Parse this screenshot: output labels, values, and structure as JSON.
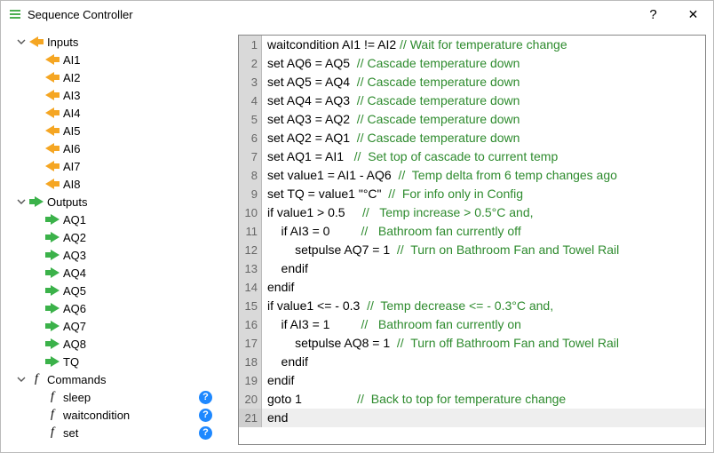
{
  "window": {
    "title": "Sequence Controller",
    "help_symbol": "?",
    "close_symbol": "✕"
  },
  "tree": {
    "inputs": {
      "label": "Inputs",
      "items": [
        "AI1",
        "AI2",
        "AI3",
        "AI4",
        "AI5",
        "AI6",
        "AI7",
        "AI8"
      ]
    },
    "outputs": {
      "label": "Outputs",
      "items": [
        "AQ1",
        "AQ2",
        "AQ3",
        "AQ4",
        "AQ5",
        "AQ6",
        "AQ7",
        "AQ8",
        "TQ"
      ]
    },
    "commands": {
      "label": "Commands",
      "items": [
        "sleep",
        "waitcondition",
        "set"
      ]
    },
    "help_badge": "?"
  },
  "code": {
    "current_line": 21,
    "lines": [
      {
        "n": 1,
        "text": "waitcondition AI1 != AI2 ",
        "comment": "// Wait for temperature change"
      },
      {
        "n": 2,
        "text": "set AQ6 = AQ5  ",
        "comment": "// Cascade temperature down"
      },
      {
        "n": 3,
        "text": "set AQ5 = AQ4  ",
        "comment": "// Cascade temperature down"
      },
      {
        "n": 4,
        "text": "set AQ4 = AQ3  ",
        "comment": "// Cascade temperature down"
      },
      {
        "n": 5,
        "text": "set AQ3 = AQ2  ",
        "comment": "// Cascade temperature down"
      },
      {
        "n": 6,
        "text": "set AQ2 = AQ1  ",
        "comment": "// Cascade temperature down"
      },
      {
        "n": 7,
        "text": "set AQ1 = AI1   ",
        "comment": "//  Set top of cascade to current temp"
      },
      {
        "n": 8,
        "text": "set value1 = AI1 - AQ6  ",
        "comment": "//  Temp delta from 6 temp changes ago"
      },
      {
        "n": 9,
        "text": "set TQ = value1 \"°C\"  ",
        "comment": "//  For info only in Config"
      },
      {
        "n": 10,
        "text": "if value1 > 0.5     ",
        "comment": "//   Temp increase > 0.5°C and,"
      },
      {
        "n": 11,
        "text": "    if AI3 = 0         ",
        "comment": "//   Bathroom fan currently off"
      },
      {
        "n": 12,
        "text": "        setpulse AQ7 = 1  ",
        "comment": "//  Turn on Bathroom Fan and Towel Rail"
      },
      {
        "n": 13,
        "text": "    endif",
        "comment": ""
      },
      {
        "n": 14,
        "text": "endif",
        "comment": ""
      },
      {
        "n": 15,
        "text": "if value1 <= - 0.3  ",
        "comment": "//  Temp decrease <= - 0.3°C and,"
      },
      {
        "n": 16,
        "text": "    if AI3 = 1         ",
        "comment": "//   Bathroom fan currently on"
      },
      {
        "n": 17,
        "text": "        setpulse AQ8 = 1  ",
        "comment": "//  Turn off Bathroom Fan and Towel Rail"
      },
      {
        "n": 18,
        "text": "    endif",
        "comment": ""
      },
      {
        "n": 19,
        "text": "endif",
        "comment": ""
      },
      {
        "n": 20,
        "text": "goto 1                ",
        "comment": "//  Back to top for temperature change"
      },
      {
        "n": 21,
        "text": "end",
        "comment": ""
      }
    ]
  }
}
